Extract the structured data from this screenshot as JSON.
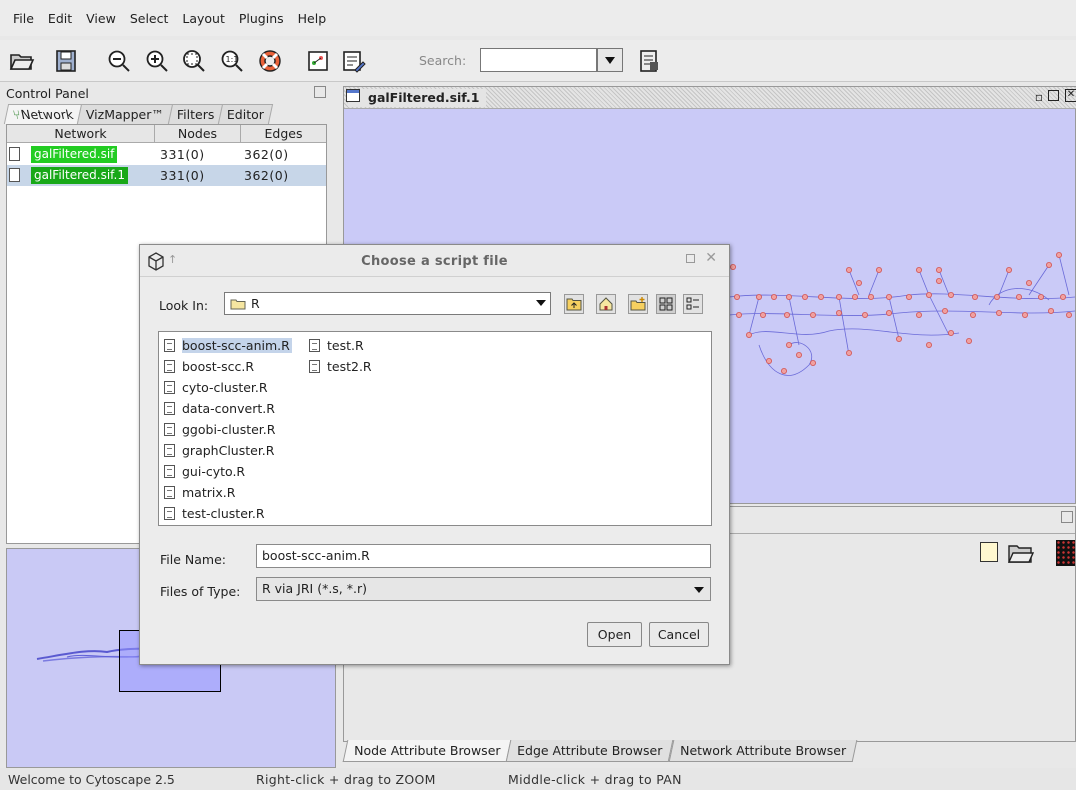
{
  "menu": [
    "File",
    "Edit",
    "View",
    "Select",
    "Layout",
    "Plugins",
    "Help"
  ],
  "toolbar": {
    "search_label": "Search:",
    "search_value": "",
    "icons": [
      "open-folder-icon",
      "save-icon",
      "zoom-out-icon",
      "zoom-in-icon",
      "zoom-fit-icon",
      "zoom-selected-icon",
      "help-lifebuoy-icon",
      "layout-icon",
      "vizmapper-icon",
      "search-options-icon"
    ]
  },
  "control_panel": {
    "title": "Control Panel",
    "tabs": [
      "Network",
      "VizMapper™",
      "Filters",
      "Editor"
    ],
    "columns": [
      "Network",
      "Nodes",
      "Edges"
    ],
    "rows": [
      {
        "name": "galFiltered.sif",
        "nodes": "331(0)",
        "edges": "362(0)"
      },
      {
        "name": "galFiltered.sif.1",
        "nodes": "331(0)",
        "edges": "362(0)"
      }
    ]
  },
  "network_view": {
    "title": "galFiltered.sif.1"
  },
  "attribute_tabs": [
    "Node Attribute Browser",
    "Edge Attribute Browser",
    "Network Attribute Browser"
  ],
  "status": {
    "left": "Welcome to Cytoscape 2.5",
    "zoom_hint": "Right-click + drag to ZOOM",
    "pan_hint": "Middle-click + drag to PAN"
  },
  "dialog": {
    "title": "Choose a script file",
    "look_in_label": "Look In:",
    "look_in_value": "R",
    "files_col1": [
      "boost-scc-anim.R",
      "boost-scc.R",
      "cyto-cluster.R",
      "data-convert.R",
      "ggobi-cluster.R",
      "graphCluster.R",
      "gui-cyto.R",
      "matrix.R",
      "test-cluster.R"
    ],
    "files_col2": [
      "test.R",
      "test2.R"
    ],
    "selected_file": "boost-scc-anim.R",
    "file_name_label": "File Name:",
    "file_name_value": "boost-scc-anim.R",
    "files_of_type_label": "Files of Type:",
    "files_of_type_value": "R via JRI (*.s, *.r)",
    "open_label": "Open",
    "cancel_label": "Cancel"
  },
  "colors": {
    "canvas_bg": "#cacaf7",
    "node_fill": "#f0a0a0",
    "edge_color": "#6a6ad8",
    "network_name_bg": "#22cc22",
    "selection": "#c4d4ea"
  }
}
